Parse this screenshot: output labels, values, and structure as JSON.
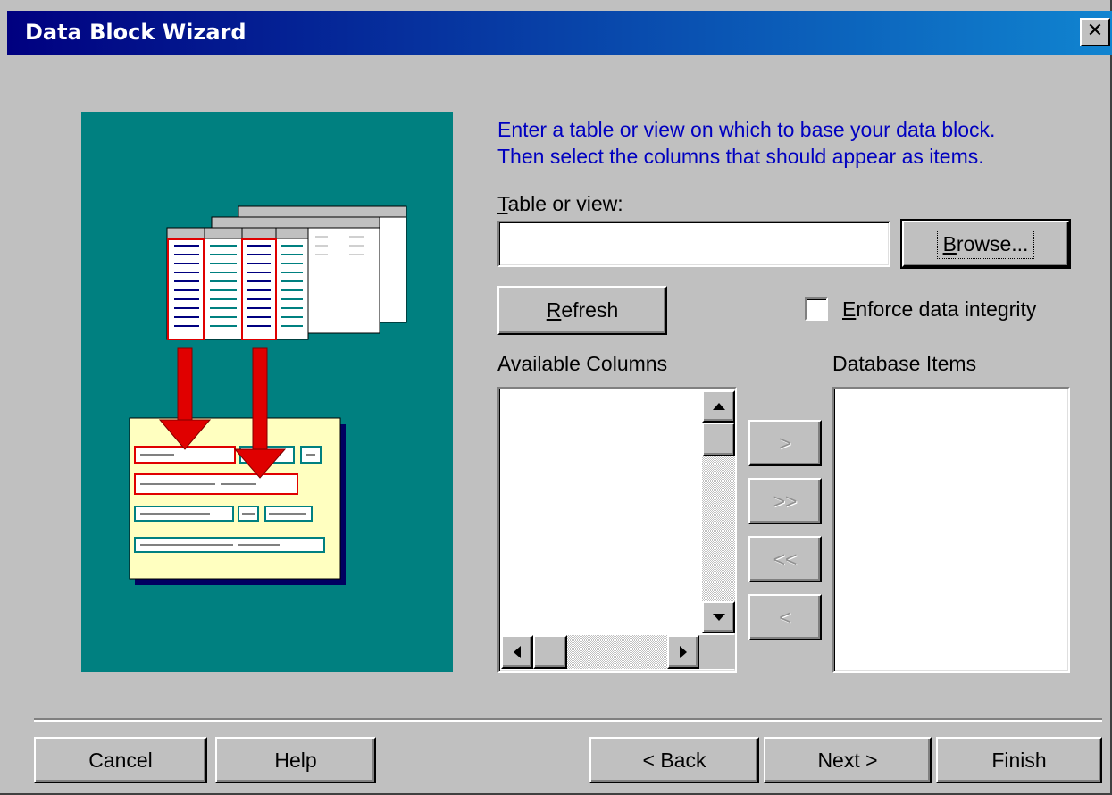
{
  "window": {
    "title": "Data Block Wizard",
    "close_glyph": "✕"
  },
  "instructions": {
    "line1": "Enter a table or view on which to base your data block.",
    "line2": "Then select the columns that should appear as items."
  },
  "table_or_view": {
    "label_mnemonic": "T",
    "label_rest": "able or view:",
    "value": ""
  },
  "buttons": {
    "browse_mnemonic": "B",
    "browse_rest": "rowse...",
    "refresh_mnemonic": "R",
    "refresh_rest": "efresh",
    "add_one": ">",
    "add_all": ">>",
    "remove_all": "<<",
    "remove_one": "<",
    "cancel": "Cancel",
    "help": "Help",
    "back": "< Back",
    "next": "Next >",
    "finish": "Finish"
  },
  "enforce_integrity": {
    "label_mnemonic": "E",
    "label_rest": "nforce data integrity",
    "checked": false
  },
  "lists": {
    "available_label": "Available Columns",
    "database_label": "Database Items",
    "available_items": [],
    "database_items": []
  },
  "colors": {
    "title_bar": "#000080",
    "illustration_bg": "#008080",
    "instructions_text": "#0000c0"
  }
}
